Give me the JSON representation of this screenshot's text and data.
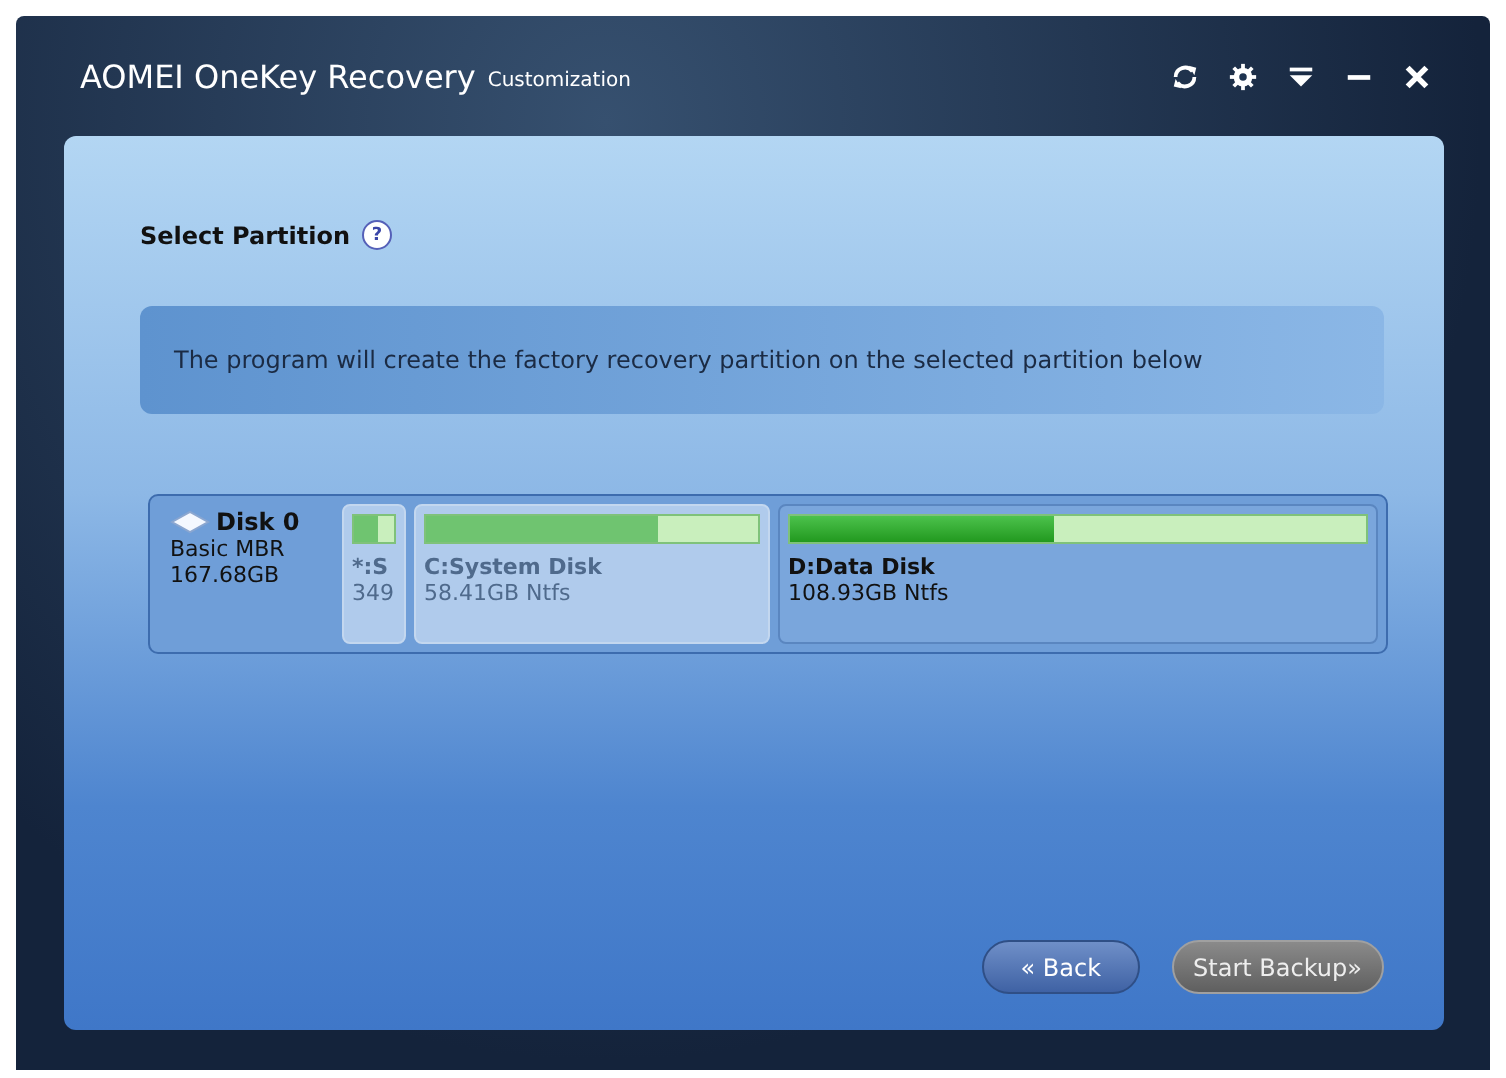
{
  "window": {
    "title": "AOMEI OneKey Recovery",
    "subtitle": "Customization"
  },
  "heading": "Select Partition",
  "help_icon": "?",
  "info": "The program will create the factory recovery partition on the selected partition below",
  "disk": {
    "name": "Disk 0",
    "type": "Basic MBR",
    "size": "167.68GB"
  },
  "partitions": [
    {
      "name": "*:S",
      "size": "349",
      "level": 0.6,
      "disabled": true
    },
    {
      "name": "C:System Disk",
      "size": "58.41GB Ntfs",
      "level": 0.7,
      "disabled": true
    },
    {
      "name": "D:Data Disk",
      "size": "108.93GB Ntfs",
      "level": 0.46,
      "disabled": false
    }
  ],
  "buttons": [
    {
      "label": "« Back",
      "disabled": false
    },
    {
      "label": "Start Backup»",
      "disabled": true
    }
  ]
}
